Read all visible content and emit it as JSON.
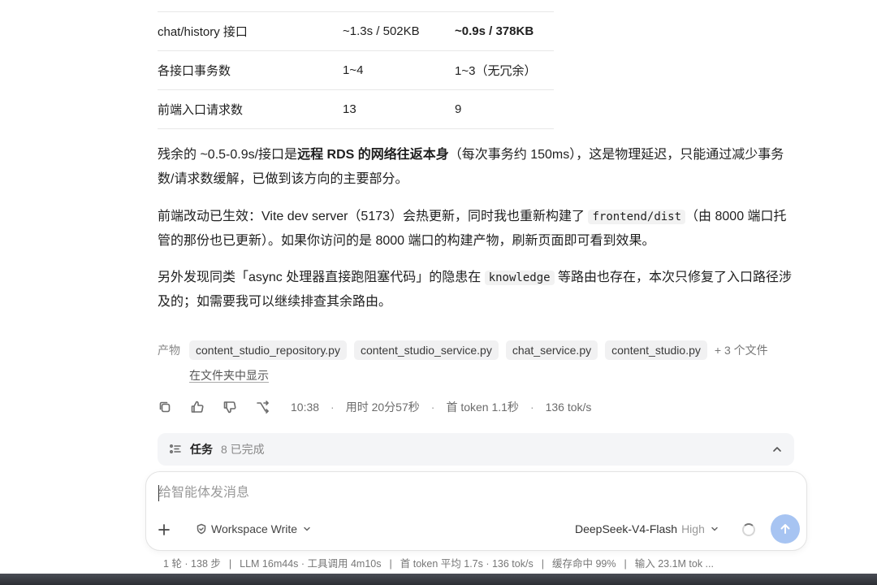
{
  "table": {
    "rows": [
      [
        "chat/history 接口",
        "~1.3s / 502KB",
        "~0.9s / 378KB"
      ],
      [
        "各接口事务数",
        "1~4",
        "1~3（无冗余）"
      ],
      [
        "前端入口请求数",
        "13",
        "9"
      ]
    ]
  },
  "paragraphs": {
    "p1": {
      "a": "残余的 ~0.5-0.9s/接口是",
      "b": "远程 RDS 的网络往返本身",
      "c": "（每次事务约 150ms），这是物理延迟，只能通过减少事务数/请求数缓解，已做到该方向的主要部分。"
    },
    "p2": {
      "a": "前端改动已生效：Vite dev server（5173）会热更新，同时我也重新构建了 ",
      "code": "frontend/dist",
      "b": "（由 8000 端口托管的那份也已更新）。如果你访问的是 8000 端口的构建产物，刷新页面即可看到效果。"
    },
    "p3": {
      "a": "另外发现同类「async 处理器直接跑阻塞代码」的隐患在 ",
      "code": "knowledge",
      "b": " 等路由也存在，本次只修复了入口路径涉及的；如需要我可以继续排查其余路由。"
    }
  },
  "artifacts": {
    "label": "产物",
    "files": [
      "content_studio_repository.py",
      "content_studio_service.py",
      "chat_service.py",
      "content_studio.py"
    ],
    "more": "+ 3 个文件",
    "show_in_folder": "在文件夹中显示"
  },
  "actions": {
    "time": "10:38",
    "elapsed": "用时 20分57秒",
    "first_token": "首 token 1.1秒",
    "speed": "136 tok/s",
    "icons": [
      "copy-icon",
      "thumbs-up-icon",
      "thumbs-down-icon",
      "branch-icon"
    ]
  },
  "tasks": {
    "title": "任务",
    "status": "8 已完成"
  },
  "composer": {
    "placeholder": "给智能体发消息",
    "mode": "Workspace Write",
    "model": "DeepSeek-V4-Flash",
    "level": "High"
  },
  "statusbar": {
    "rounds": "1 轮 · 138 步",
    "llm": "LLM 16m44s · 工具调用 4m10s",
    "token_avg": "首 token 平均 1.7s · 136 tok/s",
    "cache": "缓存命中 99%",
    "input": "输入 23.1M tok ..."
  }
}
